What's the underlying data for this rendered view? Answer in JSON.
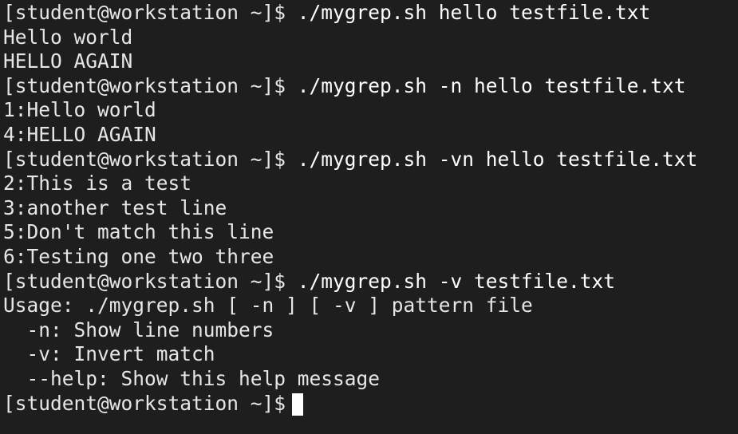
{
  "prompt": "[student@workstation ~]$",
  "highlight_color": "#d81b1b",
  "session": [
    {
      "command": "./mygrep.sh hello testfile.txt",
      "output": [
        "Hello world",
        "HELLO AGAIN"
      ]
    },
    {
      "command": "./mygrep.sh -n hello testfile.txt",
      "output": [
        "1:Hello world",
        "4:HELLO AGAIN"
      ]
    },
    {
      "command": "./mygrep.sh -vn hello testfile.txt",
      "output": [
        "2:This is a test",
        "3:another test line",
        "5:Don't match this line",
        "6:Testing one two three"
      ]
    },
    {
      "command": "./mygrep.sh -v testfile.txt",
      "output": [
        "Usage: ./mygrep.sh [ -n ] [ -v ] pattern file",
        "  -n: Show line numbers",
        "  -v: Invert match",
        "  --help: Show this help message"
      ]
    }
  ]
}
